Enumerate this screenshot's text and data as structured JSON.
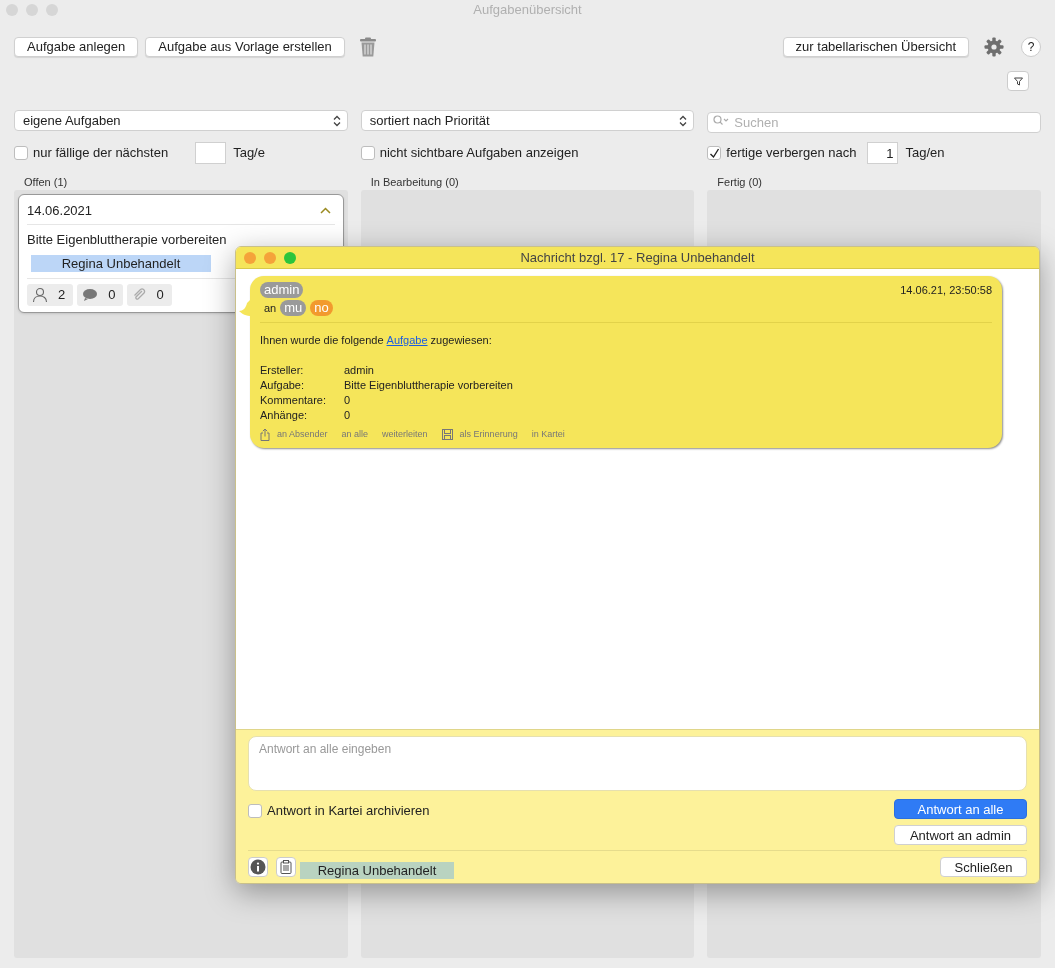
{
  "window": {
    "title": "Aufgabenübersicht"
  },
  "toolbar": {
    "buttons": [
      "Aufgabe anlegen",
      "Aufgabe aus Vorlage erstellen"
    ],
    "overview_button": "zur tabellarischen Übersicht",
    "help": "?"
  },
  "filters": {
    "owner_select": "eigene Aufgaben",
    "sort_select": "sortiert nach Priorität",
    "search": {
      "placeholder": "Suchen"
    },
    "options": [
      {
        "label": "nur fällige der nächsten",
        "checked": false,
        "unit": "Tag/e"
      },
      {
        "label": "nicht sichtbare Aufgaben anzeigen",
        "checked": false
      },
      {
        "label": "fertige verbergen nach",
        "checked": true,
        "value": "1",
        "unit": "Tag/en"
      }
    ]
  },
  "columns": [
    {
      "title": "Offen (1)",
      "cards": [
        {
          "date": "14.06.2021",
          "expanded": true,
          "title": "Bitte Eigenbluttherapie vorbereiten",
          "patient": "Regina Unbehandelt",
          "people": "2",
          "comments": "0",
          "attachments": "0"
        }
      ]
    },
    {
      "title": "In Bearbeitung (0)"
    },
    {
      "title": "Fertig (0)"
    }
  ],
  "dialog": {
    "title": "Nachricht bzgl. 17 - Regina Unbehandelt",
    "message": {
      "sender": "admin",
      "to_label": "an",
      "recipients": [
        {
          "name": "mu",
          "color": "#9a9a9a"
        },
        {
          "name": "no",
          "color": "#f29a2e"
        }
      ],
      "timestamp": "14.06.21, 23:50:58",
      "intro_before": "Ihnen wurde die folgende",
      "intro_link": "Aufgabe",
      "intro_after": "zugewiesen:",
      "fields": [
        {
          "label": "Ersteller:",
          "value": "admin"
        },
        {
          "label": "Aufgabe:",
          "value": "Bitte Eigenbluttherapie vorbereiten"
        },
        {
          "label": "Kommentare:",
          "value": "0"
        },
        {
          "label": "Anhänge:",
          "value": "0"
        }
      ],
      "actions": [
        {
          "label": "an Absender"
        },
        {
          "label": "an alle"
        },
        {
          "label": "weiterleiten"
        },
        {
          "label": "als Erinnerung"
        },
        {
          "label": "in Kartei"
        }
      ]
    },
    "reply": {
      "placeholder": "Antwort an alle eingeben",
      "archive": {
        "label": "Antwort in Kartei archivieren",
        "checked": false
      },
      "buttons": [
        {
          "label": "Antwort an alle",
          "default": true
        },
        {
          "label": "Antwort an admin",
          "default": false
        }
      ]
    },
    "footer": {
      "patient": "Regina Unbehandelt",
      "close": "Schließen"
    }
  }
}
